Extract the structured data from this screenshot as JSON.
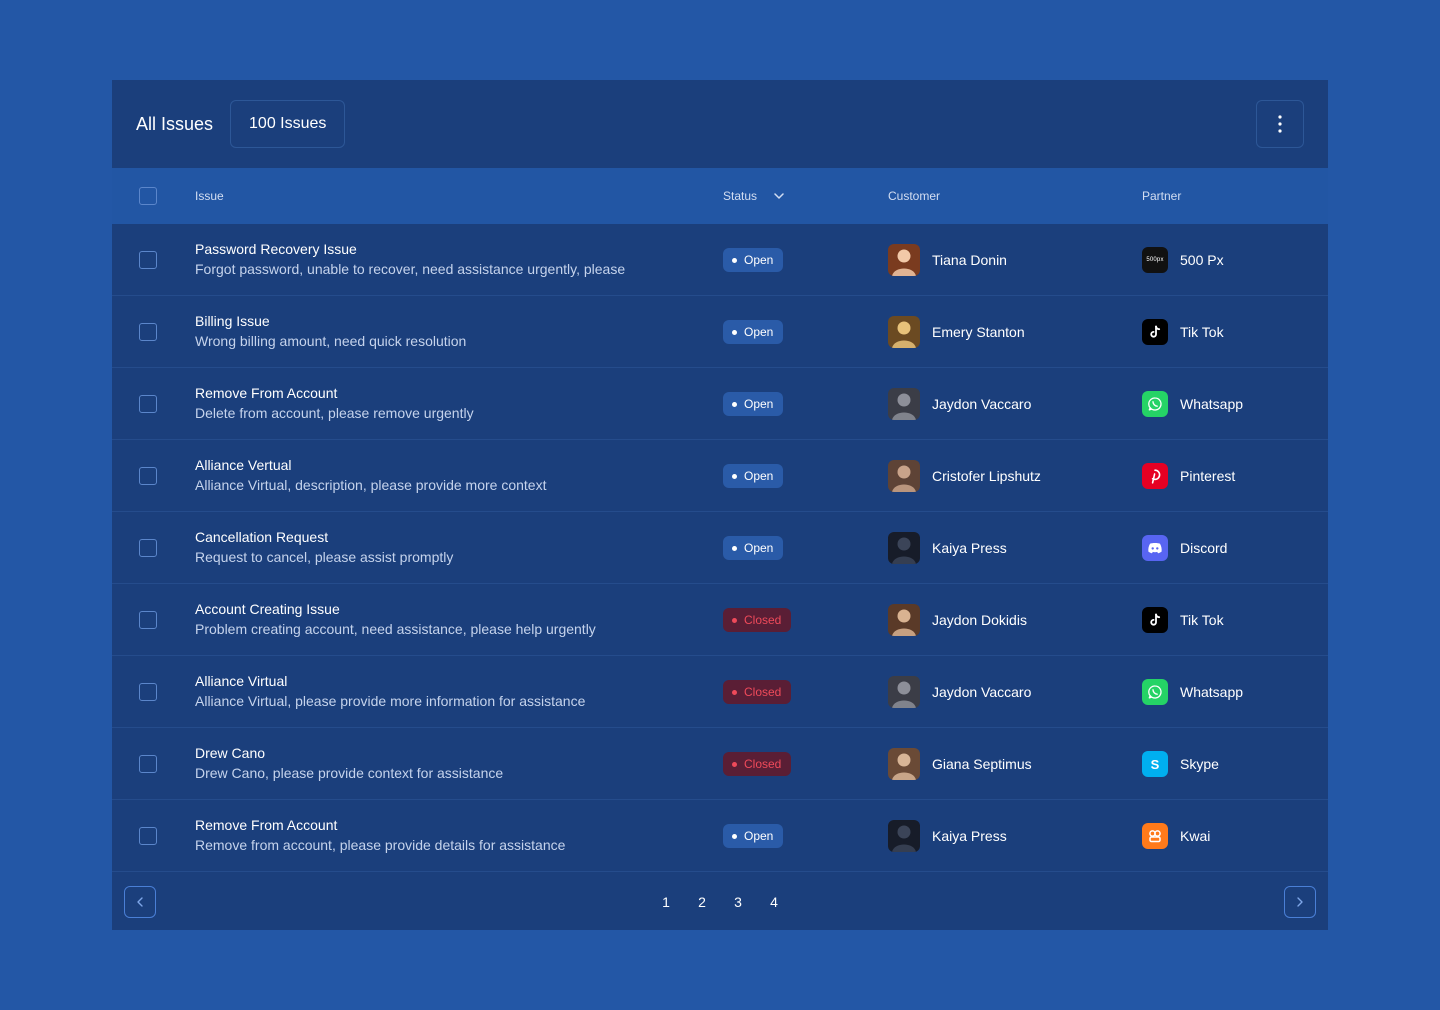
{
  "header": {
    "title": "All Issues",
    "count_label": "100 Issues"
  },
  "columns": {
    "issue": "Issue",
    "status": "Status",
    "customer": "Customer",
    "partner": "Partner"
  },
  "rows": [
    {
      "title": "Password Recovery Issue",
      "desc": "Forgot password, unable to recover, need assistance urgently, please",
      "status": "Open",
      "customer": "Tiana Donin",
      "partner": "500 Px",
      "partner_icon": "500px-icon"
    },
    {
      "title": "Billing Issue",
      "desc": "Wrong billing amount, need quick resolution",
      "status": "Open",
      "customer": "Emery Stanton",
      "partner": "Tik Tok",
      "partner_icon": "tiktok-icon"
    },
    {
      "title": "Remove From Account",
      "desc": "Delete from account, please remove urgently",
      "status": "Open",
      "customer": "Jaydon Vaccaro",
      "partner": "Whatsapp",
      "partner_icon": "whatsapp-icon"
    },
    {
      "title": "Alliance Vertual",
      "desc": "Alliance Virtual, description, please provide more context",
      "status": "Open",
      "customer": "Cristofer Lipshutz",
      "partner": "Pinterest",
      "partner_icon": "pinterest-icon"
    },
    {
      "title": "Cancellation Request",
      "desc": "Request to cancel, please assist promptly",
      "status": "Open",
      "customer": "Kaiya Press",
      "partner": "Discord",
      "partner_icon": "discord-icon"
    },
    {
      "title": "Account Creating Issue",
      "desc": "Problem creating account, need assistance, please help urgently",
      "status": "Closed",
      "customer": "Jaydon Dokidis",
      "partner": "Tik Tok",
      "partner_icon": "tiktok-icon"
    },
    {
      "title": "Alliance Virtual",
      "desc": "Alliance Virtual, please provide more information for assistance",
      "status": "Closed",
      "customer": "Jaydon Vaccaro",
      "partner": "Whatsapp",
      "partner_icon": "whatsapp-icon"
    },
    {
      "title": "Drew Cano",
      "desc": "Drew Cano, please provide context for assistance",
      "status": "Closed",
      "customer": "Giana Septimus",
      "partner": "Skype",
      "partner_icon": "skype-icon"
    },
    {
      "title": "Remove From Account",
      "desc": "Remove from account, please provide details for assistance",
      "status": "Open",
      "customer": "Kaiya Press",
      "partner": "Kwai",
      "partner_icon": "kwai-icon"
    }
  ],
  "pagination": {
    "pages": [
      "1",
      "2",
      "3",
      "4"
    ]
  },
  "colors": {
    "page_bg": "#2357a6",
    "panel_bg": "#1b3f7c",
    "header_row_bg": "#2256a4",
    "open_badge_bg": "#2a5ba8",
    "closed_badge_bg": "#5a1e35",
    "closed_text": "#ef4a5a",
    "whatsapp": "#25d366",
    "pinterest": "#e60023",
    "discord": "#5865f2",
    "skype": "#00aff0",
    "kwai": "#ff7a1a"
  }
}
